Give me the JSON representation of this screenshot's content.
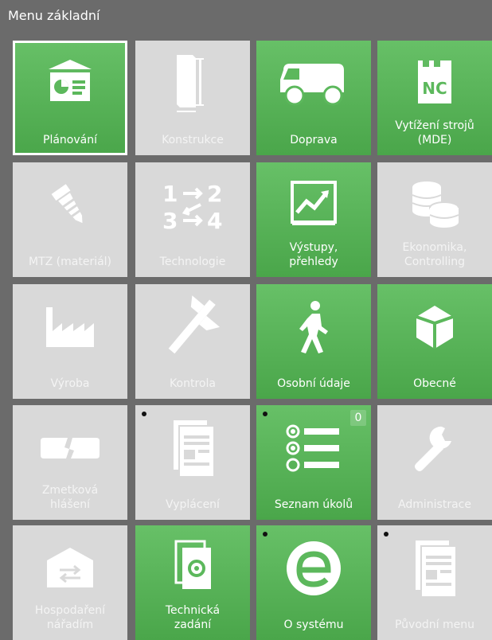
{
  "header": {
    "title": "Menu základní"
  },
  "tiles": [
    {
      "label": "Plánování"
    },
    {
      "label": "Konstrukce"
    },
    {
      "label": "Doprava"
    },
    {
      "label": "Vytížení strojů\n(MDE)"
    },
    {
      "label": "MTZ (materiál)"
    },
    {
      "label": "Technologie"
    },
    {
      "label": "Výstupy,\npřehledy"
    },
    {
      "label": "Ekonomika,\nControlling"
    },
    {
      "label": "Výroba"
    },
    {
      "label": "Kontrola"
    },
    {
      "label": "Osobní údaje"
    },
    {
      "label": "Obecné"
    },
    {
      "label": "Zmetková\nhlášení"
    },
    {
      "label": "Vyplácení"
    },
    {
      "label": "Seznam úkolů",
      "badge": "0"
    },
    {
      "label": "Administrace"
    },
    {
      "label": "Hospodaření\nnářadím"
    },
    {
      "label": "Technická\nzadání"
    },
    {
      "label": "O systému"
    },
    {
      "label": "Původní menu"
    }
  ],
  "colors": {
    "green": "#5cb85c",
    "gray": "#d9d9d9",
    "frame": "#6b6b6b",
    "selected_outline": "#ffffff"
  },
  "icons": [
    "presentation-icon",
    "dimension-icon",
    "van-icon",
    "nc-machine-icon",
    "screw-icon",
    "numbers-swap-icon",
    "chart-icon",
    "coins-icon",
    "factory-icon",
    "caliper-icon",
    "walking-person-icon",
    "cube-icon",
    "broken-part-icon",
    "document-icon",
    "task-list-icon",
    "wrench-icon",
    "tool-warehouse-icon",
    "tech-document-icon",
    "e-logo-icon",
    "document-icon"
  ]
}
